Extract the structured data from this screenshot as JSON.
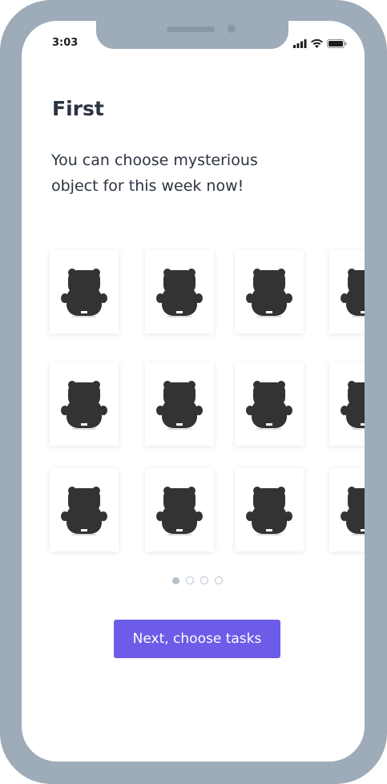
{
  "status_bar": {
    "time": "3:03",
    "icons": [
      "signal-icon",
      "wifi-icon",
      "battery-icon"
    ]
  },
  "page": {
    "title": "First",
    "subtitle": "You can choose mysterious object for this week now!"
  },
  "objects": {
    "icon": "bear-silhouette-icon",
    "rows": 3,
    "visible_columns": 4,
    "count": 12
  },
  "pagination": {
    "total": 4,
    "active_index": 0
  },
  "next_button": {
    "label": "Next, choose tasks"
  },
  "colors": {
    "frame": "#9eabb9",
    "accent": "#6c5ce7",
    "object": "#333333",
    "text": "#2b3440"
  }
}
